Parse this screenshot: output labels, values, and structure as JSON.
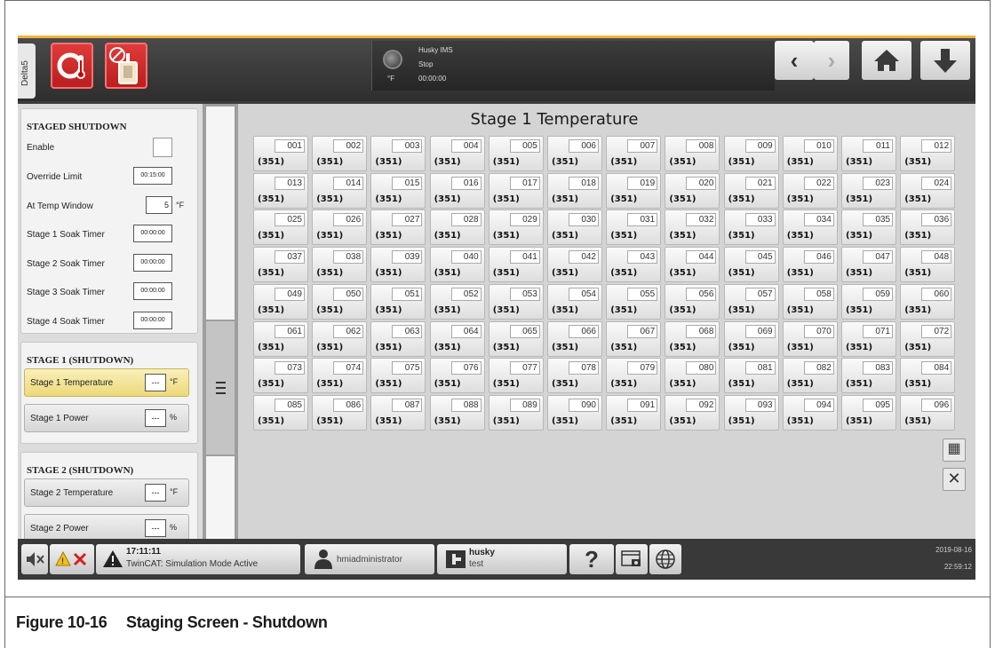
{
  "topbar": {
    "side_tab": "Delta5",
    "status_title": "Husky IMS",
    "status_state": "Stop",
    "status_unit": "°F",
    "status_time": "00:00:00"
  },
  "staged_shutdown": {
    "title": "STAGED SHUTDOWN",
    "rows": [
      {
        "label": "Enable",
        "value": ""
      },
      {
        "label": "Override Limit",
        "value": "00:15:00"
      },
      {
        "label": "At Temp Window",
        "value": "5",
        "unit": "°F"
      },
      {
        "label": "Stage 1 Soak Timer",
        "value": "00:00:00"
      },
      {
        "label": "Stage 2 Soak Timer",
        "value": "00:00:00"
      },
      {
        "label": "Stage 3 Soak Timer",
        "value": "00:00:00"
      },
      {
        "label": "Stage 4 Soak Timer",
        "value": "00:00:00"
      }
    ]
  },
  "stage1": {
    "title": "STAGE 1 (SHUTDOWN)",
    "temp_label": "Stage 1 Temperature",
    "temp_value": "---",
    "temp_unit": "°F",
    "power_label": "Stage 1 Power",
    "power_value": "---",
    "power_unit": "%"
  },
  "stage2": {
    "title": "STAGE 2 (SHUTDOWN)",
    "temp_label": "Stage 2 Temperature",
    "temp_value": "---",
    "temp_unit": "°F",
    "power_label": "Stage 2 Power",
    "power_value": "---",
    "power_unit": "%"
  },
  "main": {
    "title": "Stage 1 Temperature",
    "zone_value": "(351)",
    "zones": [
      "001",
      "002",
      "003",
      "004",
      "005",
      "006",
      "007",
      "008",
      "009",
      "010",
      "011",
      "012",
      "013",
      "014",
      "015",
      "016",
      "017",
      "018",
      "019",
      "020",
      "021",
      "022",
      "023",
      "024",
      "025",
      "026",
      "027",
      "028",
      "029",
      "030",
      "031",
      "032",
      "033",
      "034",
      "035",
      "036",
      "037",
      "038",
      "039",
      "040",
      "041",
      "042",
      "043",
      "044",
      "045",
      "046",
      "047",
      "048",
      "049",
      "050",
      "051",
      "052",
      "053",
      "054",
      "055",
      "056",
      "057",
      "058",
      "059",
      "060",
      "061",
      "062",
      "063",
      "064",
      "065",
      "066",
      "067",
      "068",
      "069",
      "070",
      "071",
      "072",
      "073",
      "074",
      "075",
      "076",
      "077",
      "078",
      "079",
      "080",
      "081",
      "082",
      "083",
      "084",
      "085",
      "086",
      "087",
      "088",
      "089",
      "090",
      "091",
      "092",
      "093",
      "094",
      "095",
      "096"
    ]
  },
  "bottombar": {
    "alarm_time": "17:11:11",
    "alarm_text": "TwinCAT: Simulation Mode Active",
    "user": "hmiadministrator",
    "mold_name": "husky",
    "mold_sub": "test",
    "help": "?",
    "date": "2019-08-16",
    "time": "22:59:12"
  },
  "caption": {
    "number": "Figure 10-16",
    "text": "Staging Screen - Shutdown"
  }
}
